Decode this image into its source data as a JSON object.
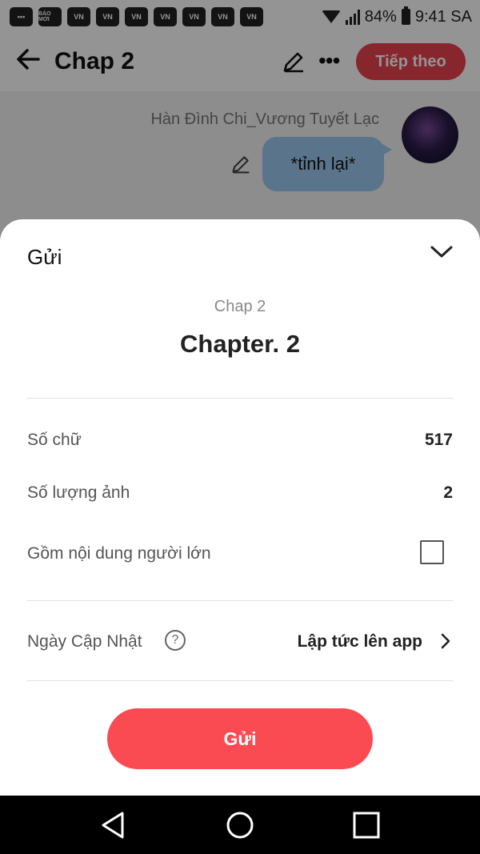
{
  "status_bar": {
    "app_icons": [
      "BÁO MỚI",
      "VN",
      "VN",
      "VN",
      "VN",
      "VN",
      "VN",
      "VN"
    ],
    "battery": "84%",
    "time": "9:41 SA",
    "icons": [
      "chat-icon",
      "wifi-icon",
      "signal-icon",
      "battery-icon"
    ]
  },
  "app_bar": {
    "title": "Chap 2",
    "next_label": "Tiếp theo",
    "icons": [
      "back-arrow-icon",
      "edit-icon",
      "more-icon"
    ]
  },
  "chat": {
    "character_name": "Hàn Đình Chi_Vương Tuyết Lạc",
    "message": "*tỉnh lại*"
  },
  "sheet": {
    "title": "Gửi",
    "chapter_subtitle": "Chap 2",
    "chapter_title": "Chapter. 2",
    "word_count_label": "Số chữ",
    "word_count_value": "517",
    "image_count_label": "Số lượng ảnh",
    "image_count_value": "2",
    "adult_content_label": "Gồm nội dung người lớn",
    "adult_content_checked": false,
    "update_date_label": "Ngày Cập Nhật",
    "update_date_value": "Lập tức lên app",
    "send_label": "Gửi"
  },
  "colors": {
    "accent": "#fa4a52",
    "next_button": "#e8424f",
    "bubble": "#9cc8ef"
  }
}
